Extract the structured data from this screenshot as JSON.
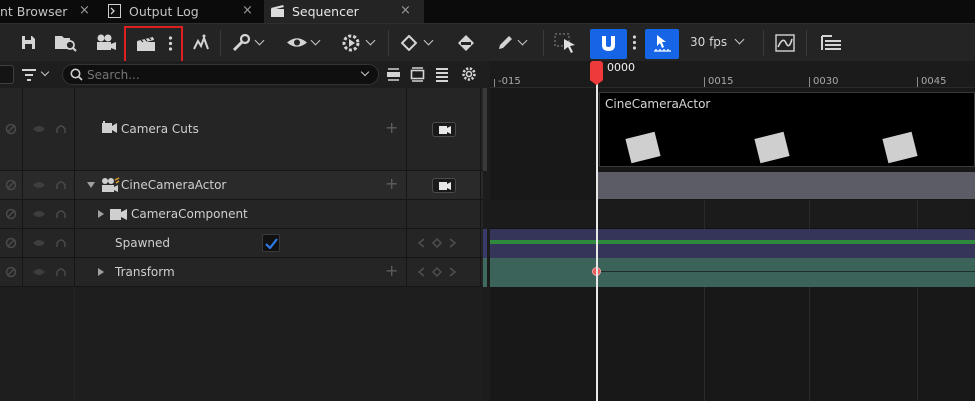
{
  "tabs": [
    {
      "label": "nt Browser",
      "close": "×"
    },
    {
      "label": "Output Log",
      "close": "×"
    },
    {
      "label": "Sequencer",
      "close": "×"
    }
  ],
  "toolbar": {
    "fps_label": "30 fps",
    "highlight_color": "#e02020",
    "accent_color": "#1565e6"
  },
  "search": {
    "placeholder": "Search..."
  },
  "tracks": [
    {
      "label": "Camera Cuts"
    },
    {
      "label": "CineCameraActor"
    },
    {
      "label": "CameraComponent"
    },
    {
      "label": "Spawned"
    },
    {
      "label": "Transform"
    }
  ],
  "timeline": {
    "current_frame": "0000",
    "ticks": [
      "-015",
      "0015",
      "0030",
      "0045"
    ],
    "clip_label": "CineCameraActor"
  }
}
